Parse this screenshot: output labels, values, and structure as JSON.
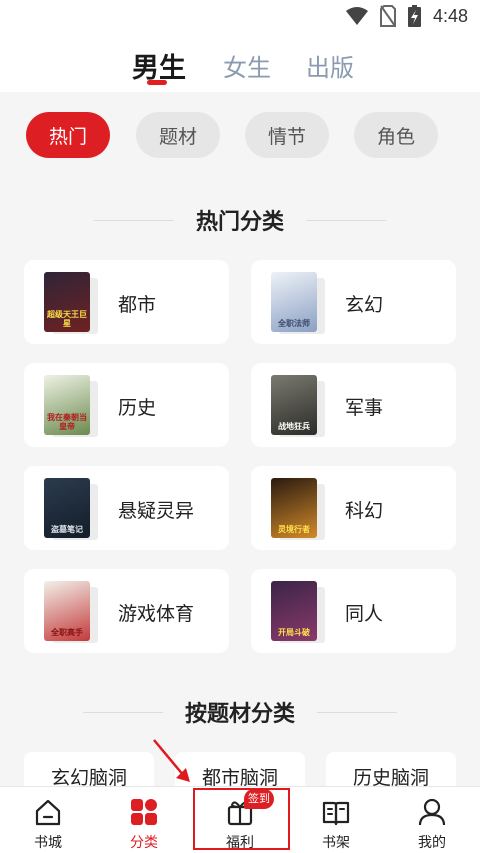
{
  "status_bar": {
    "time": "4:48",
    "icons": [
      "wifi-icon",
      "no-sim-icon",
      "battery-charging-icon"
    ]
  },
  "top_tabs": [
    {
      "label": "男生",
      "active": true
    },
    {
      "label": "女生",
      "active": false
    },
    {
      "label": "出版",
      "active": false
    }
  ],
  "chips": [
    {
      "label": "热门",
      "active": true
    },
    {
      "label": "题材",
      "active": false
    },
    {
      "label": "情节",
      "active": false
    },
    {
      "label": "角色",
      "active": false
    }
  ],
  "sections": {
    "hot": "热门分类",
    "topic": "按题材分类"
  },
  "categories": [
    {
      "label": "都市",
      "cover_text": "超级天王巨星",
      "cover_colors": [
        "#3a2b3e",
        "#8a2a2a"
      ]
    },
    {
      "label": "玄幻",
      "cover_text": "全职法师",
      "cover_colors": [
        "#dfe6ef",
        "#8ba0c4"
      ]
    },
    {
      "label": "历史",
      "cover_text": "我在秦朝当皇帝",
      "cover_colors": [
        "#e9eee0",
        "#6b8a4f"
      ]
    },
    {
      "label": "军事",
      "cover_text": "战地狂兵",
      "cover_colors": [
        "#5b5b55",
        "#2c2c28"
      ]
    },
    {
      "label": "悬疑灵异",
      "cover_text": "盗墓笔记",
      "cover_colors": [
        "#2b3b4e",
        "#141d29"
      ]
    },
    {
      "label": "科幻",
      "cover_text": "灵境行者",
      "cover_colors": [
        "#4a2b1a",
        "#d28a2a"
      ]
    },
    {
      "label": "游戏体育",
      "cover_text": "全职高手",
      "cover_colors": [
        "#f2f0ea",
        "#c23a3a"
      ]
    },
    {
      "label": "同人",
      "cover_text": "开局斗破",
      "cover_colors": [
        "#3b2448",
        "#7a3a6a"
      ]
    }
  ],
  "topics": [
    "玄幻脑洞",
    "都市脑洞",
    "历史脑洞"
  ],
  "bottom_nav": [
    {
      "label": "书城",
      "icon": "home-icon",
      "active": false
    },
    {
      "label": "分类",
      "icon": "category-grid-icon",
      "active": true
    },
    {
      "label": "福利",
      "icon": "gift-icon",
      "active": false,
      "badge": "签到"
    },
    {
      "label": "书架",
      "icon": "bookshelf-icon",
      "active": false
    },
    {
      "label": "我的",
      "icon": "profile-icon",
      "active": false
    }
  ],
  "colors": {
    "accent": "#dd1f23",
    "inactive_tab": "#8a9bb0",
    "background": "#f5f5f6"
  }
}
